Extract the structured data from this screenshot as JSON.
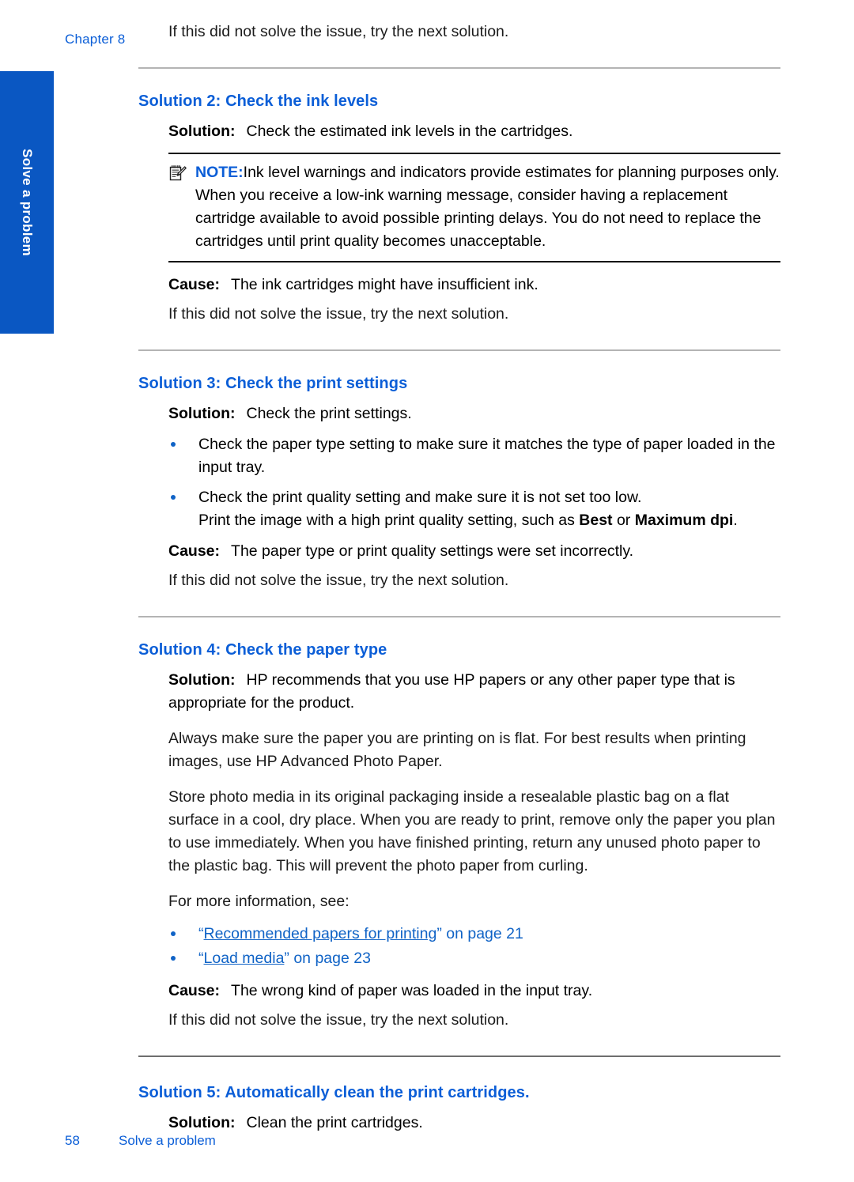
{
  "header": {
    "chapter_label": "Chapter 8"
  },
  "side_tab": {
    "label": "Solve a problem",
    "color": "#0a57c2"
  },
  "colors": {
    "heading_blue": "#0b5ed7",
    "link_blue": "#1063c6",
    "bullet_blue": "#1063c6",
    "rule_gray": "#b4b4b4",
    "note_rule": "#111111"
  },
  "intro": {
    "retry_line": "If this did not solve the issue, try the next solution."
  },
  "sections": [
    {
      "heading": "Solution 2: Check the ink levels",
      "solution_label": "Solution:",
      "solution_text": "Check the estimated ink levels in the cartridges.",
      "note": {
        "icon": "note-pad-pencil-icon",
        "label": "NOTE:",
        "text": "Ink level warnings and indicators provide estimates for planning purposes only. When you receive a low-ink warning message, consider having a replacement cartridge available to avoid possible printing delays. You do not need to replace the cartridges until print quality becomes unacceptable."
      },
      "cause_label": "Cause:",
      "cause_text": "The ink cartridges might have insufficient ink.",
      "retry_line": "If this did not solve the issue, try the next solution."
    },
    {
      "heading": "Solution 3: Check the print settings",
      "solution_label": "Solution:",
      "solution_text": "Check the print settings.",
      "bullets": [
        {
          "text": "Check the paper type setting to make sure it matches the type of paper loaded in the input tray."
        },
        {
          "text": "Check the print quality setting and make sure it is not set too low.",
          "sub_pre": "Print the image with a high print quality setting, such as ",
          "sub_bold_1": "Best",
          "sub_mid": " or ",
          "sub_bold_2": "Maximum dpi",
          "sub_post": "."
        }
      ],
      "cause_label": "Cause:",
      "cause_text": "The paper type or print quality settings were set incorrectly.",
      "retry_line": "If this did not solve the issue, try the next solution."
    },
    {
      "heading": "Solution 4: Check the paper type",
      "solution_label": "Solution:",
      "solution_text": "HP recommends that you use HP papers or any other paper type that is appropriate for the product.",
      "paragraphs": [
        "Always make sure the paper you are printing on is flat. For best results when printing images, use HP Advanced Photo Paper.",
        "Store photo media in its original packaging inside a resealable plastic bag on a flat surface in a cool, dry place. When you are ready to print, remove only the paper you plan to use immediately. When you have finished printing, return any unused photo paper to the plastic bag. This will prevent the photo paper from curling.",
        "For more information, see:"
      ],
      "xrefs": [
        {
          "open_quote": "“",
          "title": "Recommended papers for printing",
          "close_quote": "”",
          "page_text": " on page 21"
        },
        {
          "open_quote": "“",
          "title": "Load media",
          "close_quote": "”",
          "page_text": " on page 23"
        }
      ],
      "cause_label": "Cause:",
      "cause_text": "The wrong kind of paper was loaded in the input tray.",
      "retry_line": "If this did not solve the issue, try the next solution."
    },
    {
      "heading": "Solution 5: Automatically clean the print cartridges.",
      "solution_label": "Solution:",
      "solution_text": "Clean the print cartridges."
    }
  ],
  "footer": {
    "page_number": "58",
    "section_name": "Solve a problem"
  }
}
